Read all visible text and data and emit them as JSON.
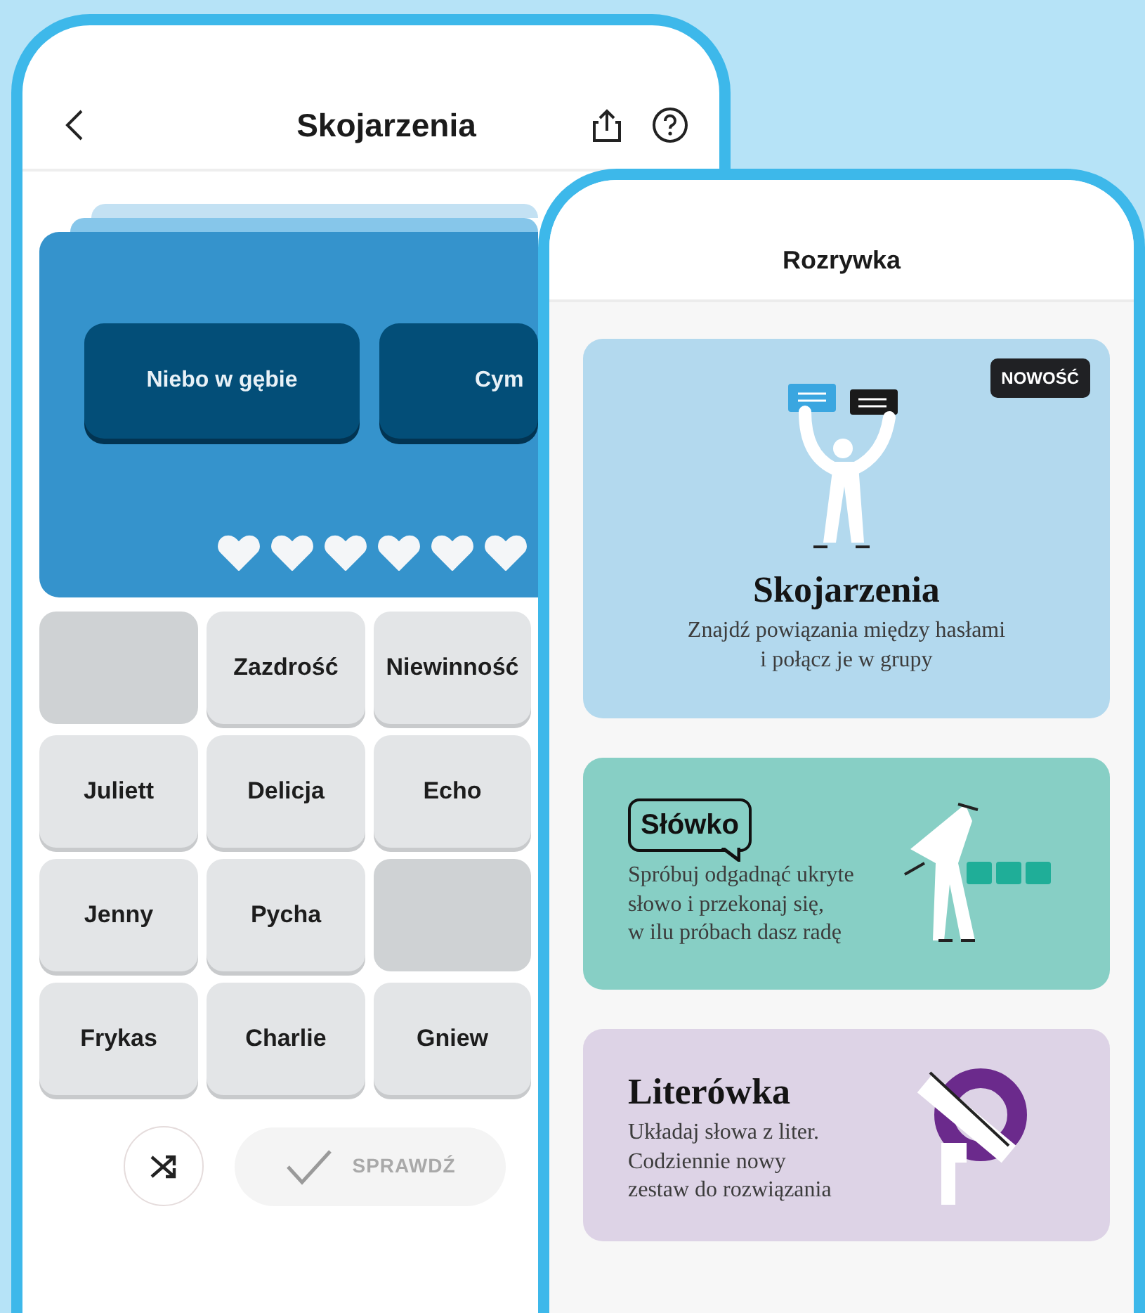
{
  "left_screen": {
    "title": "Skojarzenia",
    "group_tiles": [
      {
        "label": "Niebo w gębie"
      },
      {
        "label": "Cym"
      }
    ],
    "hearts": [
      {
        "filled": true
      },
      {
        "filled": true
      },
      {
        "filled": true
      },
      {
        "filled": true
      },
      {
        "filled": true
      },
      {
        "filled": true
      }
    ],
    "tiles": [
      {
        "kind": "blank"
      },
      {
        "kind": "word",
        "label": "Zazdrość"
      },
      {
        "kind": "word",
        "label": "Niewinność"
      },
      {
        "kind": "word",
        "label": "Juliett"
      },
      {
        "kind": "word",
        "label": "Delicja"
      },
      {
        "kind": "word",
        "label": "Echo"
      },
      {
        "kind": "word",
        "label": "Jenny"
      },
      {
        "kind": "word",
        "label": "Pycha"
      },
      {
        "kind": "blank"
      },
      {
        "kind": "word",
        "label": "Frykas"
      },
      {
        "kind": "word",
        "label": "Charlie"
      },
      {
        "kind": "word",
        "label": "Gniew"
      }
    ],
    "check_button": {
      "label": "SPRAWDŹ",
      "disabled": true
    }
  },
  "right_screen": {
    "title": "Rozrywka",
    "games": [
      {
        "kind": "featured",
        "title": "Skojarzenia",
        "description": "Znajdź powiązania między hasłami\ni połącz je w grupy",
        "badge": "NOWOŚĆ",
        "color": "#b3d9ee"
      },
      {
        "kind": "logo",
        "title": "Słówko",
        "description": "Spróbuj odgadnąć ukryte\nsłowo i przekonaj się,\nw ilu próbach dasz radę",
        "color": "#87cfc5"
      },
      {
        "kind": "side",
        "title": "Literówka",
        "description": "Układaj słowa z liter.\nCodziennie nowy\nzestaw do rozwiązania",
        "color": "#ddd3e6"
      }
    ]
  }
}
